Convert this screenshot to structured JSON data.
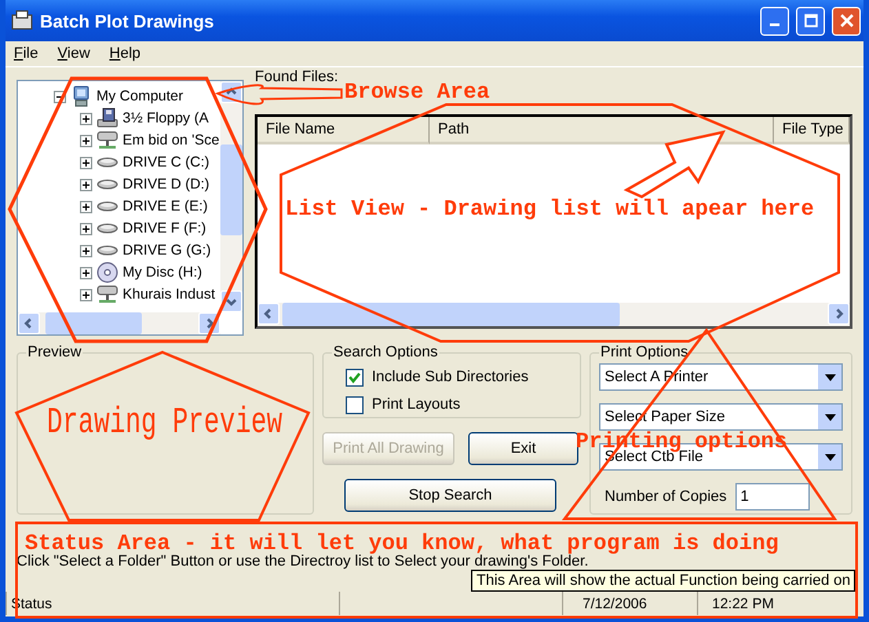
{
  "window": {
    "title": "Batch Plot Drawings"
  },
  "menu": [
    {
      "label": "File"
    },
    {
      "label": "View"
    },
    {
      "label": "Help"
    }
  ],
  "tree": {
    "items": [
      {
        "label": "My Computer",
        "kind": "computer",
        "expanded": true,
        "children": [
          {
            "label": "3½ Floppy (A",
            "kind": "floppy",
            "expanded": false
          },
          {
            "label": "Em bid on 'Sce",
            "kind": "network",
            "expanded": false
          },
          {
            "label": "DRIVE C (C:)",
            "kind": "drive",
            "expanded": false
          },
          {
            "label": "DRIVE D (D:)",
            "kind": "drive",
            "expanded": false
          },
          {
            "label": "DRIVE E (E:)",
            "kind": "drive",
            "expanded": false
          },
          {
            "label": "DRIVE F (F:)",
            "kind": "drive",
            "expanded": false
          },
          {
            "label": "DRIVE G (G:)",
            "kind": "drive",
            "expanded": false
          },
          {
            "label": "My Disc (H:)",
            "kind": "disc",
            "expanded": false
          },
          {
            "label": "Khurais Indust",
            "kind": "network",
            "expanded": false
          }
        ]
      }
    ]
  },
  "found_files": {
    "label": "Found Files:",
    "columns": [
      "File Name",
      "Path",
      "File Type"
    ]
  },
  "preview": {
    "title": "Preview"
  },
  "search_options": {
    "title": "Search Options",
    "checkboxes": [
      {
        "label": "Include Sub Directories",
        "checked": true
      },
      {
        "label": "Print Layouts",
        "checked": false
      }
    ]
  },
  "buttons": [
    {
      "label": "Print All Drawing",
      "disabled": true
    },
    {
      "label": "Exit",
      "disabled": false
    },
    {
      "label": "Stop Search",
      "disabled": false
    }
  ],
  "print_options": {
    "title": "Print Options",
    "dropdowns": [
      {
        "value": "Select A Printer"
      },
      {
        "value": "Select Paper Size"
      },
      {
        "value": "Select Ctb File"
      }
    ],
    "copies": {
      "label": "Number of Copies",
      "value": "1"
    }
  },
  "status_area": {
    "message": "Click \"Select a Folder\" Button or use the Directroy list to Select your drawing's Folder."
  },
  "tooltip": {
    "text": "This Area will show the actual Function being carried on"
  },
  "status_bar": {
    "label": "Status",
    "date": "7/12/2006",
    "time": "12:22 PM"
  },
  "annotations": [
    {
      "kind": "browse",
      "text": "Browse Area"
    },
    {
      "kind": "list",
      "text": "List View - Drawing list will apear here"
    },
    {
      "kind": "preview",
      "text": "Drawing Preview"
    },
    {
      "kind": "printing",
      "text": "Printing options"
    },
    {
      "kind": "status",
      "text": "Status Area - it will let you know, what program is doing"
    }
  ]
}
